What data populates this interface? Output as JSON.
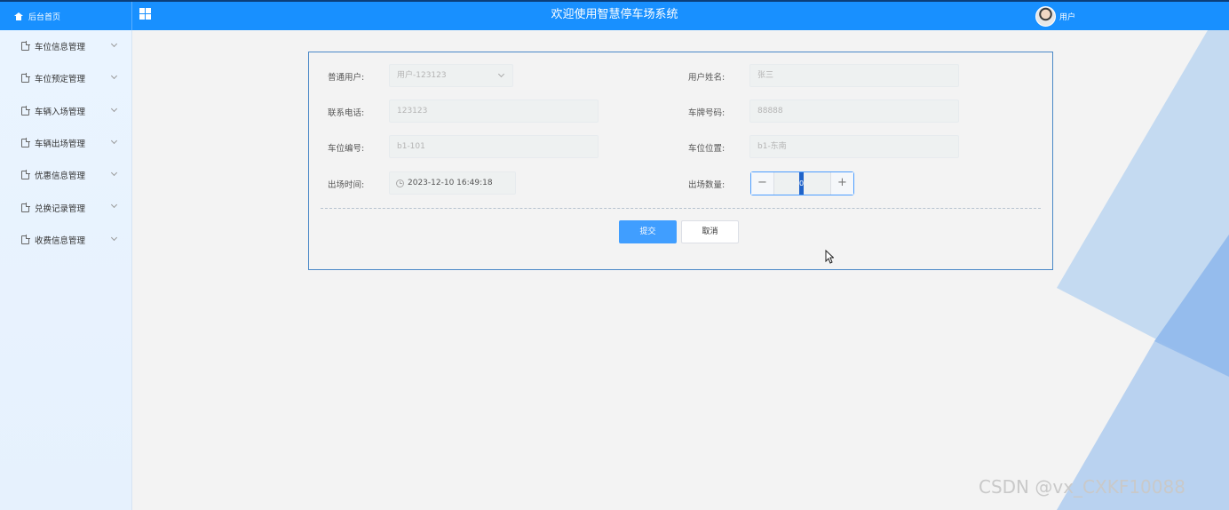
{
  "header": {
    "brand_label": "后台首页",
    "site_title": "欢迎使用智慧停车场系统",
    "user_label": "用户",
    "colors": {
      "primary": "#1890ff"
    }
  },
  "sidebar": {
    "items": [
      {
        "label": "车位信息管理"
      },
      {
        "label": "车位预定管理"
      },
      {
        "label": "车辆入场管理"
      },
      {
        "label": "车辆出场管理"
      },
      {
        "label": "优惠信息管理"
      },
      {
        "label": "兑换记录管理"
      },
      {
        "label": "收费信息管理"
      }
    ]
  },
  "form": {
    "user_select": {
      "label": "普通用户:",
      "value": "用户-123123"
    },
    "user_name": {
      "label": "用户姓名:",
      "value": "张三"
    },
    "phone": {
      "label": "联系电话:",
      "value": "123123"
    },
    "plate": {
      "label": "车牌号码:",
      "value": "88888"
    },
    "spot_no": {
      "label": "车位编号:",
      "value": "b1-101"
    },
    "spot_location": {
      "label": "车位位置:",
      "value": "b1-东南"
    },
    "exit_time": {
      "label": "出场时间:",
      "value": "2023-12-10 16:49:18"
    },
    "exit_count": {
      "label": "出场数量:",
      "value": "0",
      "minus": "−",
      "plus": "+"
    },
    "submit_label": "提交",
    "cancel_label": "取消"
  },
  "watermark": "CSDN @vx_CXKF10088"
}
